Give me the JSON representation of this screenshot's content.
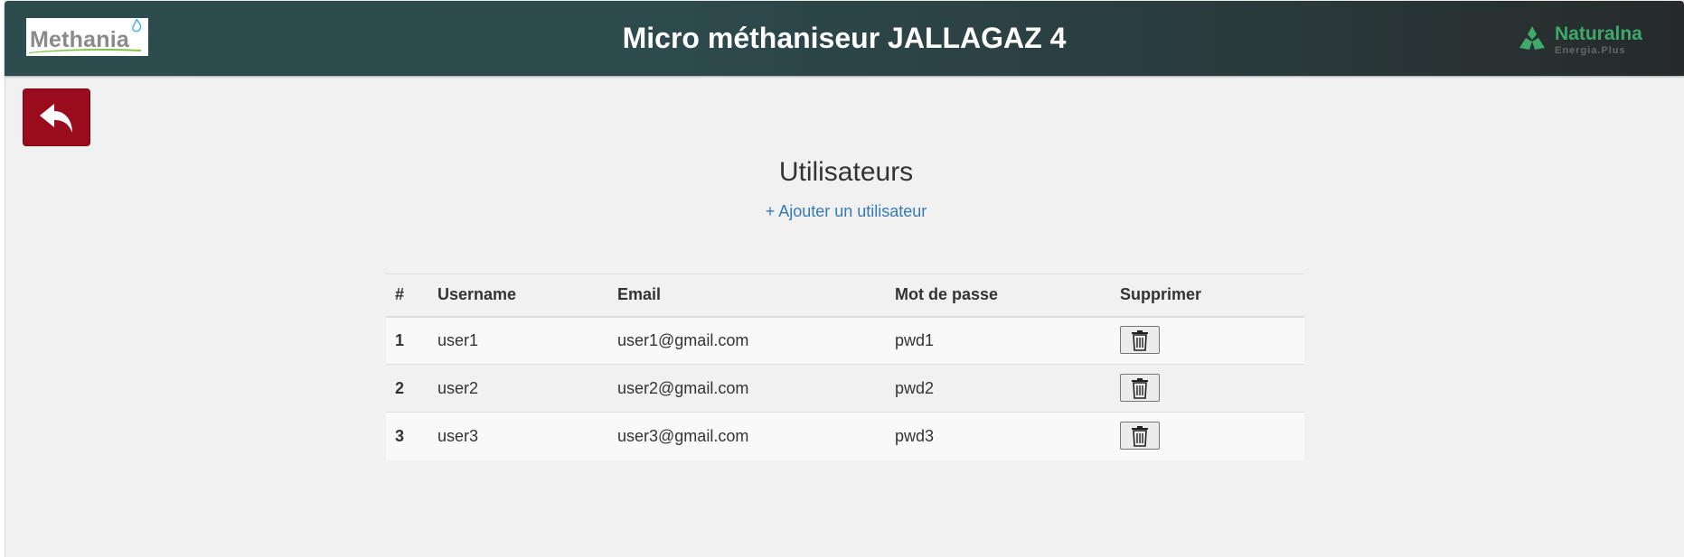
{
  "header": {
    "title": "Micro méthaniseur JALLAGAZ 4",
    "left_logo": {
      "text": "Methania",
      "icon": "methania-logo"
    },
    "right_logo": {
      "name": "Naturalna",
      "sub": "Energia.Plus",
      "icon": "naturalna-logo"
    }
  },
  "back_button": {
    "icon": "reply-arrow-icon",
    "color": "#9b0b1e"
  },
  "page": {
    "title": "Utilisateurs",
    "add_link": "+ Ajouter un utilisateur"
  },
  "table": {
    "columns": [
      "#",
      "Username",
      "Email",
      "Mot de passe",
      "Supprimer"
    ],
    "rows": [
      {
        "num": "1",
        "username": "user1",
        "email": "user1@gmail.com",
        "password": "pwd1"
      },
      {
        "num": "2",
        "username": "user2",
        "email": "user2@gmail.com",
        "password": "pwd2"
      },
      {
        "num": "3",
        "username": "user3",
        "email": "user3@gmail.com",
        "password": "pwd3"
      }
    ],
    "delete_icon": "trash-icon"
  },
  "colors": {
    "header_start": "#2c4c4e",
    "header_end": "#262a2b",
    "link": "#337ab7",
    "back_button": "#9b0b1e",
    "brand_green": "#3fa96b"
  }
}
